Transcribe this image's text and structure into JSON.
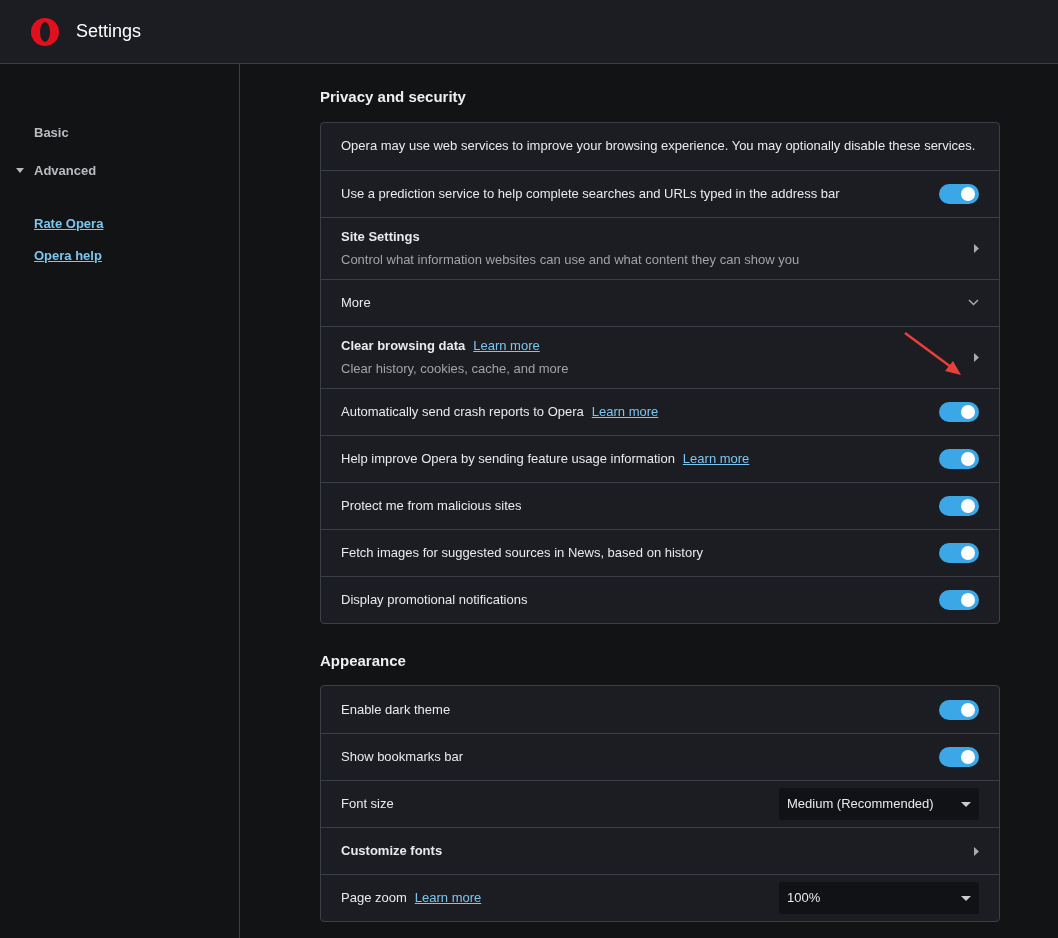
{
  "window": {
    "title": "Settings"
  },
  "sidebar": {
    "items": [
      {
        "label": "Basic",
        "kind": "plain"
      },
      {
        "label": "Advanced",
        "kind": "expandable",
        "expanded": true
      }
    ],
    "links": [
      "Rate Opera",
      "Opera help"
    ]
  },
  "sections": [
    {
      "title": "Privacy and security",
      "rows": [
        {
          "kind": "info",
          "label": "Opera may use web services to improve your browsing experience. You may optionally disable these services."
        },
        {
          "kind": "toggle",
          "label": "Use a prediction service to help complete searches and URLs typed in the address bar",
          "on": true
        },
        {
          "kind": "nav",
          "label": "Site Settings",
          "subtitle": "Control what information websites can use and what content they can show you"
        },
        {
          "kind": "expand",
          "label": "More",
          "expanded": false
        },
        {
          "kind": "nav",
          "label": "Clear browsing data",
          "link": "Learn more",
          "subtitle": "Clear history, cookies, cache, and more",
          "annotated": true
        },
        {
          "kind": "toggle",
          "label": "Automatically send crash reports to Opera",
          "link": "Learn more",
          "on": true
        },
        {
          "kind": "toggle",
          "label": "Help improve Opera by sending feature usage information",
          "link": "Learn more",
          "on": true
        },
        {
          "kind": "toggle",
          "label": "Protect me from malicious sites",
          "on": true
        },
        {
          "kind": "toggle",
          "label": "Fetch images for suggested sources in News, based on history",
          "on": true
        },
        {
          "kind": "toggle",
          "label": "Display promotional notifications",
          "on": true
        }
      ]
    },
    {
      "title": "Appearance",
      "rows": [
        {
          "kind": "toggle",
          "label": "Enable dark theme",
          "on": true
        },
        {
          "kind": "toggle",
          "label": "Show bookmarks bar",
          "on": true
        },
        {
          "kind": "select",
          "label": "Font size",
          "value": "Medium (Recommended)"
        },
        {
          "kind": "nav",
          "label": "Customize fonts"
        },
        {
          "kind": "select",
          "label": "Page zoom",
          "link": "Learn more",
          "value": "100%"
        }
      ]
    }
  ]
}
